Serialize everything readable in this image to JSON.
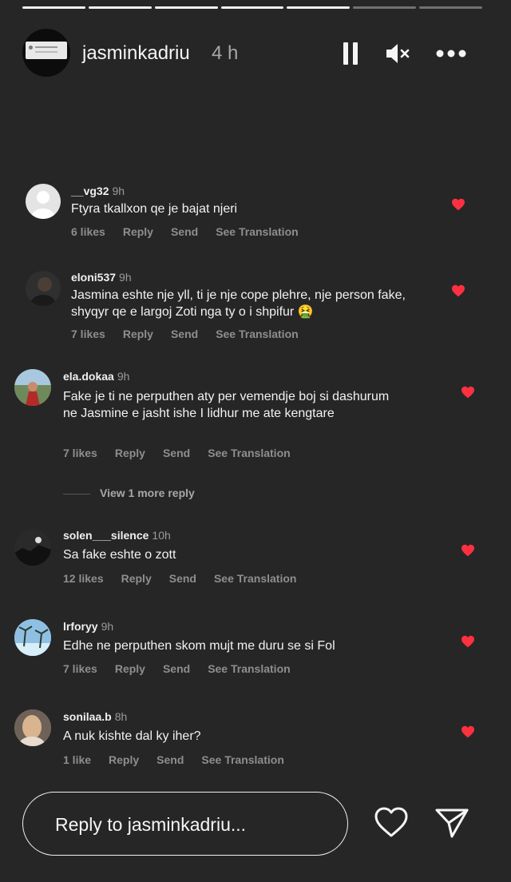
{
  "story": {
    "progress": {
      "total": 7,
      "completed": 5
    },
    "username": "jasminkadriu",
    "time": "4 h"
  },
  "comments": [
    {
      "user": "__vg32",
      "time": "9h",
      "text": "Ftyra tkallxon qe je bajat njeri",
      "likes": "6 likes",
      "reply": "Reply",
      "send": "Send",
      "translate": "See Translation",
      "avatar_color": "#e4e4e4"
    },
    {
      "user": "eloni537",
      "time": "9h",
      "text": "Jasmina eshte nje yll, ti je nje cope plehre, nje person fake, shyqyr qe e largoj Zoti nga ty o i shpifur 🤮",
      "likes": "7 likes",
      "reply": "Reply",
      "send": "Send",
      "translate": "See Translation",
      "avatar_color": "#3a3a3a"
    },
    {
      "user": "ela.dokaa",
      "time": "9h",
      "text": "Fake je ti ne perputhen aty per vemendje boj si dashurum ne Jasmine e jasht ishe I lidhur me ate kengtare",
      "likes": "7 likes",
      "reply": "Reply",
      "send": "Send",
      "translate": "See Translation",
      "avatar_color": "#5f7a4a"
    },
    {
      "user": "solen___silence",
      "time": "10h",
      "text": "Sa fake eshte o zott",
      "likes": "12 likes",
      "reply": "Reply",
      "send": "Send",
      "translate": "See Translation",
      "avatar_color": "#1f1f1f"
    },
    {
      "user": "lrforyy",
      "time": "9h",
      "text": "Edhe ne perputhen skom mujt me duru se si Fol",
      "likes": "7 likes",
      "reply": "Reply",
      "send": "Send",
      "translate": "See Translation",
      "avatar_color": "#7fb0d6"
    },
    {
      "user": "sonilaa.b",
      "time": "8h",
      "text": "A nuk kishte dal ky iher?",
      "likes": "1 like",
      "reply": "Reply",
      "send": "Send",
      "translate": "See Translation",
      "avatar_color": "#8a7a6a"
    }
  ],
  "view_more": "View 1 more reply",
  "reply_placeholder": "Reply to jasminkadriu...",
  "icons": {
    "pause": "pause-icon",
    "mute": "speaker-muted-icon",
    "more": "more-horizontal-icon",
    "like": "heart-outline-icon",
    "share": "paper-plane-icon"
  },
  "colors": {
    "background": "#262626",
    "heart": "#ff3040",
    "meta": "#8e8e8e"
  }
}
